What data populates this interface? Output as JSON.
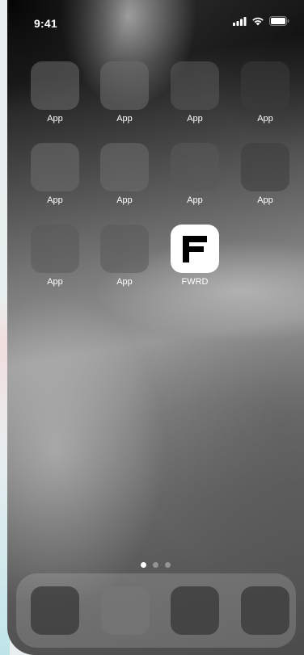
{
  "status_bar": {
    "time": "9:41",
    "icons": [
      "cellular-signal-icon",
      "wifi-icon",
      "battery-icon"
    ]
  },
  "home_screen": {
    "rows": [
      [
        {
          "label": "App"
        },
        {
          "label": "App"
        },
        {
          "label": "App"
        },
        {
          "label": "App"
        }
      ],
      [
        {
          "label": "App"
        },
        {
          "label": "App"
        },
        {
          "label": "App"
        },
        {
          "label": "App"
        }
      ],
      [
        {
          "label": "App"
        },
        {
          "label": "App"
        },
        {
          "label": "FWRD",
          "icon": "fwrd-logo-icon"
        }
      ]
    ]
  },
  "page_indicator": {
    "pages": 3,
    "current": 1
  },
  "dock": {
    "apps": 4
  },
  "colors": {
    "label_text": "#ffffff",
    "fwrd_background": "#ffffff",
    "fwrd_mark": "#000000"
  }
}
